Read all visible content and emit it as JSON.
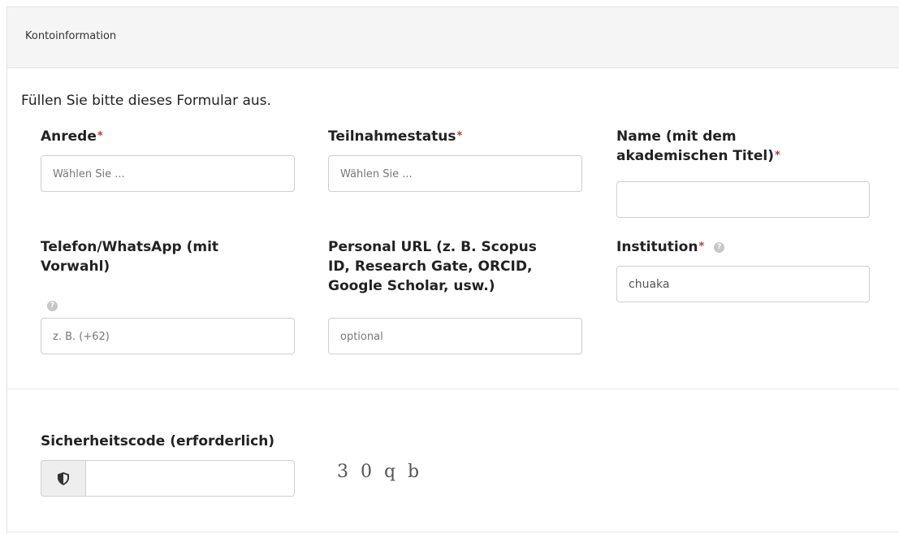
{
  "panel": {
    "title": "Kontoinformation"
  },
  "intro": "Füllen Sie bitte dieses Formular aus.",
  "required_marker": "*",
  "fields": {
    "anrede": {
      "label": "Anrede",
      "placeholder": "Wählen Sie ..."
    },
    "teilnahmestatus": {
      "label": "Teilnahmestatus",
      "placeholder": "Wählen Sie ..."
    },
    "name": {
      "label_line1": "Name (mit dem",
      "label_line2": "akademischen Titel)",
      "value": ""
    },
    "telefon": {
      "label_line1": "Telefon/WhatsApp (mit",
      "label_line2": "Vorwahl)",
      "placeholder": "z. B. (+62)"
    },
    "personal_url": {
      "label_line1": "Personal URL (z. B. Scopus",
      "label_line2": "ID, Research Gate, ORCID,",
      "label_line3": "Google Scholar, usw.)",
      "placeholder": "optional"
    },
    "institution": {
      "label": "Institution",
      "value": "chuaka"
    },
    "security_code": {
      "label": "Sicherheitscode (erforderlich)",
      "value": "",
      "captcha_text": "3 0 q b"
    }
  },
  "icons": {
    "help": "question-circle-icon",
    "shield": "shield-icon"
  },
  "colors": {
    "required": "#c0392b",
    "help_icon": "#c7c7c7",
    "panel_heading_bg": "#f5f5f5"
  }
}
